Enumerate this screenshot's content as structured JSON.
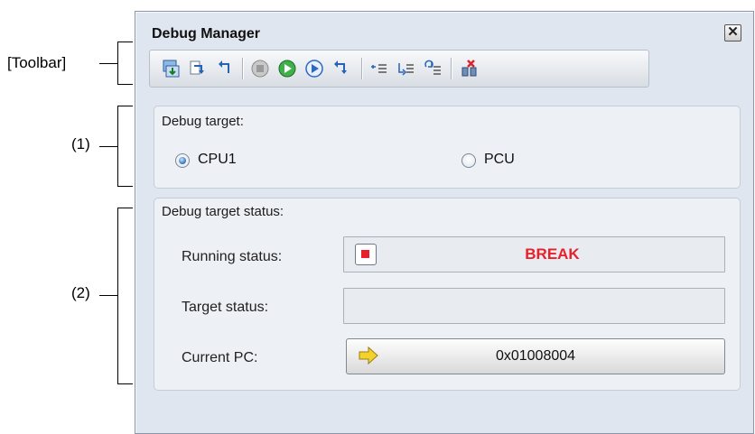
{
  "callouts": {
    "toolbar": "[Toolbar]",
    "one": "(1)",
    "two": "(2)"
  },
  "window": {
    "title": "Debug Manager",
    "close_glyph": "✕"
  },
  "toolbar": {
    "buttons": [
      {
        "icon": "download-icon"
      },
      {
        "icon": "step-into-icon"
      },
      {
        "icon": "return-icon"
      },
      {
        "icon": "stop-icon"
      },
      {
        "icon": "go-icon"
      },
      {
        "icon": "go-outline-icon"
      },
      {
        "icon": "step-over-icon"
      },
      {
        "icon": "breakpoint-list-icon"
      },
      {
        "icon": "trace-icon"
      },
      {
        "icon": "refresh-list-icon"
      },
      {
        "icon": "disconnect-icon"
      }
    ]
  },
  "debug_target": {
    "label": "Debug target:",
    "options": [
      {
        "label": "CPU1",
        "selected": true
      },
      {
        "label": "PCU",
        "selected": false
      }
    ]
  },
  "status": {
    "label": "Debug target status:",
    "running_label": "Running status:",
    "running_value": "BREAK",
    "running_color": "#e8202a",
    "target_label": "Target status:",
    "target_value": "",
    "pc_label": "Current PC:",
    "pc_value": "0x01008004"
  }
}
